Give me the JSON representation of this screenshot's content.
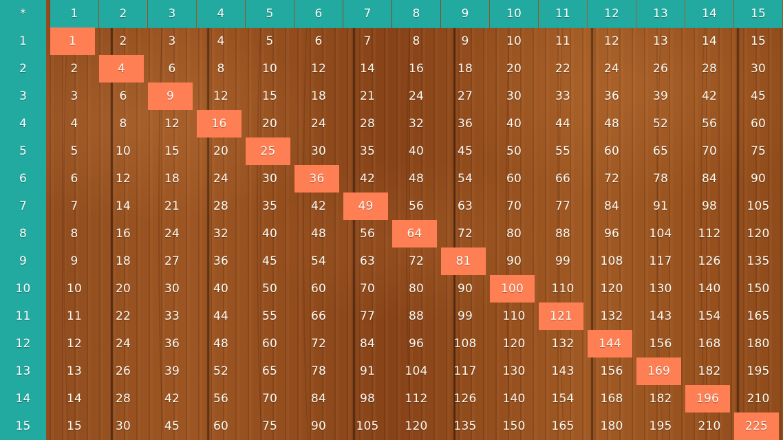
{
  "board": {
    "corner_label": "*",
    "headers": [
      "1",
      "2",
      "3",
      "4",
      "5",
      "6",
      "7",
      "8",
      "9",
      "10",
      "11",
      "12",
      "13",
      "14",
      "15"
    ],
    "rows": [
      {
        "label": "1",
        "values": [
          "1",
          "2",
          "3",
          "4",
          "5",
          "6",
          "7",
          "8",
          "9",
          "10",
          "11",
          "12",
          "13",
          "14",
          "15"
        ]
      },
      {
        "label": "2",
        "values": [
          "2",
          "4",
          "6",
          "8",
          "10",
          "12",
          "14",
          "16",
          "18",
          "20",
          "22",
          "24",
          "26",
          "28",
          "30"
        ]
      },
      {
        "label": "3",
        "values": [
          "3",
          "6",
          "9",
          "12",
          "15",
          "18",
          "21",
          "24",
          "27",
          "30",
          "33",
          "36",
          "39",
          "42",
          "45"
        ]
      },
      {
        "label": "4",
        "values": [
          "4",
          "8",
          "12",
          "16",
          "20",
          "24",
          "28",
          "32",
          "36",
          "40",
          "44",
          "48",
          "52",
          "56",
          "60"
        ]
      },
      {
        "label": "5",
        "values": [
          "5",
          "10",
          "15",
          "20",
          "25",
          "30",
          "35",
          "40",
          "45",
          "50",
          "55",
          "60",
          "65",
          "70",
          "75"
        ]
      },
      {
        "label": "6",
        "values": [
          "6",
          "12",
          "18",
          "24",
          "30",
          "36",
          "42",
          "48",
          "54",
          "60",
          "66",
          "72",
          "78",
          "84",
          "90"
        ]
      },
      {
        "label": "7",
        "values": [
          "7",
          "14",
          "21",
          "28",
          "35",
          "42",
          "49",
          "56",
          "63",
          "70",
          "77",
          "84",
          "91",
          "98",
          "105"
        ]
      },
      {
        "label": "8",
        "values": [
          "8",
          "16",
          "24",
          "32",
          "40",
          "48",
          "56",
          "64",
          "72",
          "80",
          "88",
          "96",
          "104",
          "112",
          "120"
        ]
      },
      {
        "label": "9",
        "values": [
          "9",
          "18",
          "27",
          "36",
          "45",
          "54",
          "63",
          "72",
          "81",
          "90",
          "99",
          "108",
          "117",
          "126",
          "135"
        ]
      },
      {
        "label": "10",
        "values": [
          "10",
          "20",
          "30",
          "40",
          "50",
          "60",
          "70",
          "80",
          "90",
          "100",
          "110",
          "120",
          "130",
          "140",
          "150"
        ]
      },
      {
        "label": "11",
        "values": [
          "11",
          "22",
          "33",
          "44",
          "55",
          "66",
          "77",
          "88",
          "99",
          "110",
          "121",
          "132",
          "143",
          "154",
          "165"
        ]
      },
      {
        "label": "12",
        "values": [
          "12",
          "24",
          "36",
          "48",
          "60",
          "72",
          "84",
          "96",
          "108",
          "120",
          "132",
          "144",
          "156",
          "168",
          "180"
        ]
      },
      {
        "label": "13",
        "values": [
          "13",
          "26",
          "39",
          "52",
          "65",
          "78",
          "91",
          "104",
          "117",
          "130",
          "143",
          "156",
          "169",
          "182",
          "195"
        ]
      },
      {
        "label": "14",
        "values": [
          "14",
          "28",
          "42",
          "56",
          "70",
          "84",
          "98",
          "112",
          "126",
          "140",
          "154",
          "168",
          "182",
          "196",
          "210"
        ]
      },
      {
        "label": "15",
        "values": [
          "15",
          "30",
          "45",
          "60",
          "75",
          "90",
          "105",
          "120",
          "135",
          "150",
          "165",
          "180",
          "195",
          "210",
          "225"
        ]
      }
    ]
  },
  "colors": {
    "header_bg": "#23aaa0",
    "highlight_bg": "#ff7f55",
    "text": "#fffaf0",
    "wood": "#8d4a1d"
  }
}
